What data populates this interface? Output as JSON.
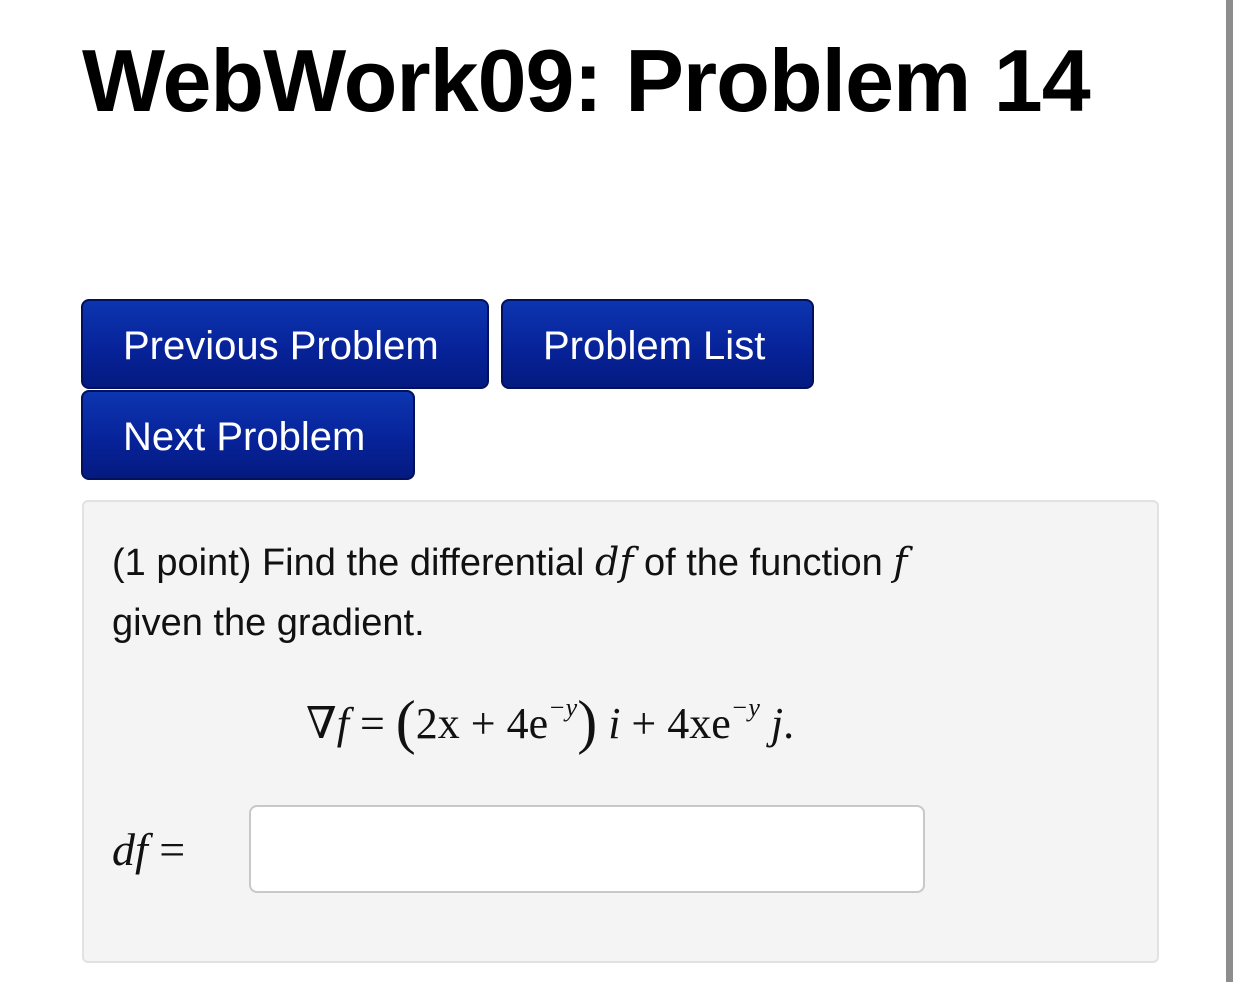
{
  "page": {
    "title": "WebWork09: Problem 14"
  },
  "nav": {
    "previous_label": "Previous Problem",
    "list_label": "Problem List",
    "next_label": "Next Problem"
  },
  "problem": {
    "points": "(1 point)",
    "text_part1": "Find the differential",
    "df": "df",
    "text_part2": "of the function",
    "f": "f",
    "text_part3": "given the gradient.",
    "formula": {
      "lhs": "∇f",
      "equals": "=",
      "open": "(",
      "term1": "2x + 4e",
      "exp1": "−y",
      "close": ")",
      "i": "i",
      "plus": "+",
      "term2": "4xe",
      "exp2": "−y",
      "j": "j",
      "end": "."
    }
  },
  "answer": {
    "label_df": "df",
    "label_eq": "=",
    "value": "",
    "placeholder": ""
  },
  "colors": {
    "button_bg": "#07239a",
    "button_border": "#02115e",
    "panel_bg": "#f4f4f4"
  }
}
